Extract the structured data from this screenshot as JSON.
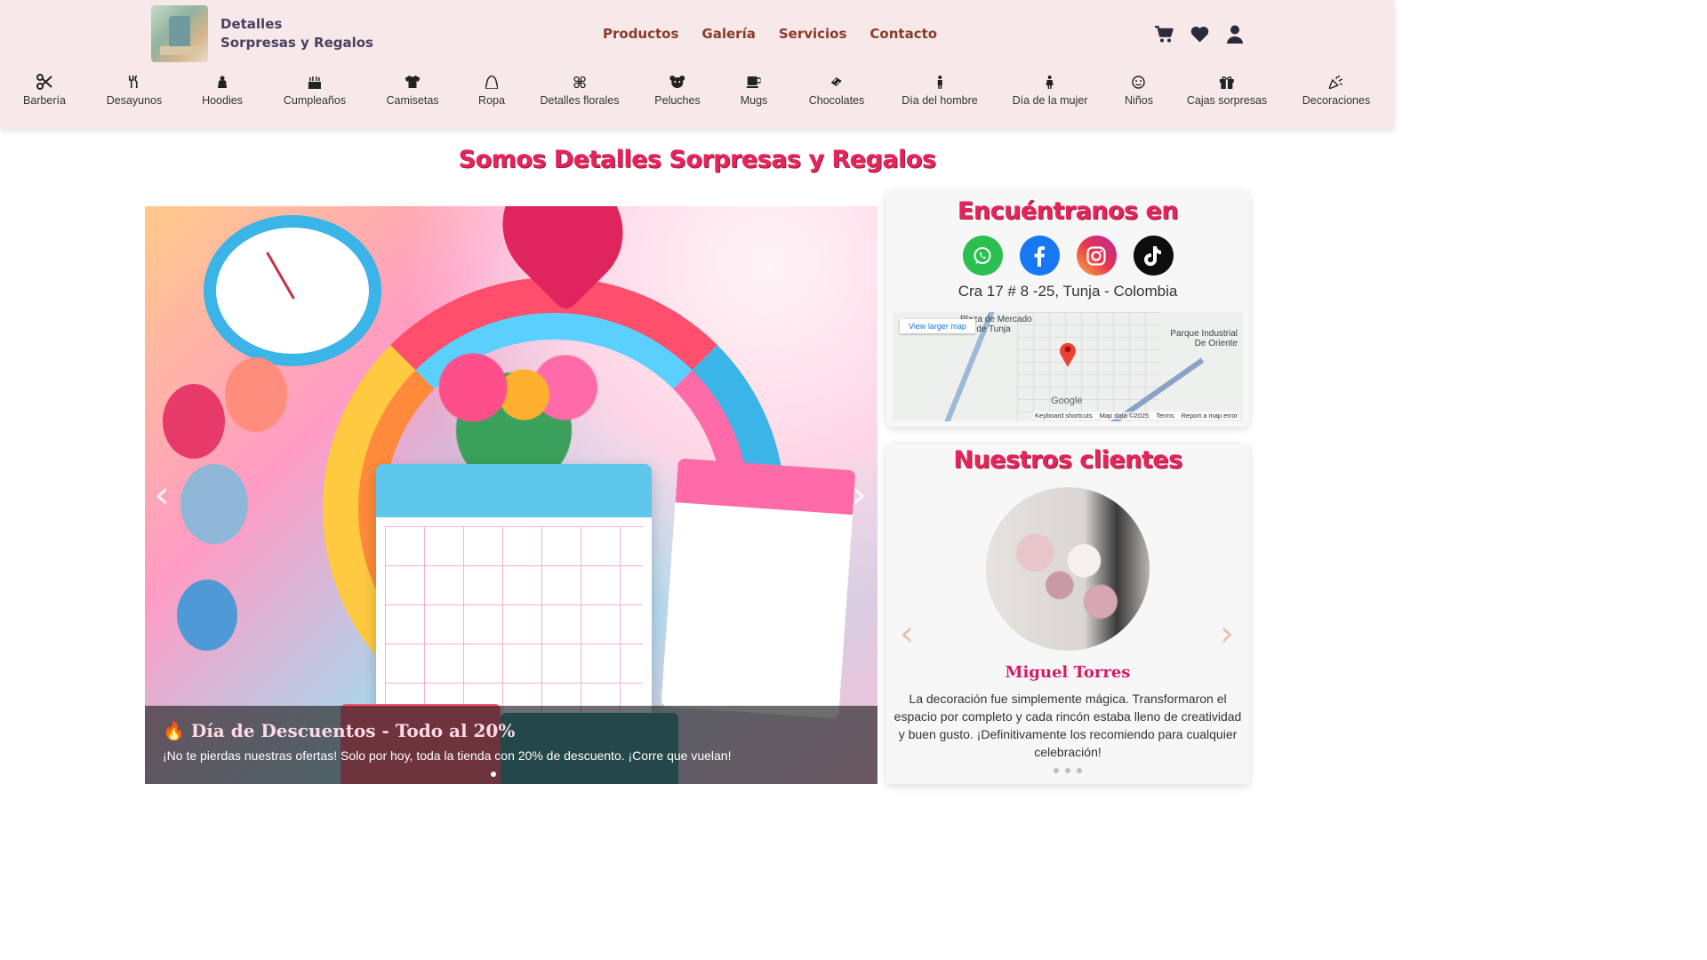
{
  "brand": {
    "line1": "Detalles",
    "line2": "Sorpresas y Regalos"
  },
  "nav": [
    {
      "label": "Productos"
    },
    {
      "label": "Galería"
    },
    {
      "label": "Servicios"
    },
    {
      "label": "Contacto"
    }
  ],
  "header_icons": [
    "cart-icon",
    "heart-icon",
    "user-icon"
  ],
  "categories": [
    {
      "label": "Barbería",
      "icon": "scissors-icon"
    },
    {
      "label": "Desayunos",
      "icon": "utensils-icon"
    },
    {
      "label": "Hoodies",
      "icon": "hoodie-icon"
    },
    {
      "label": "Cumpleaños",
      "icon": "birthday-cake-icon"
    },
    {
      "label": "Camisetas",
      "icon": "tshirt-icon"
    },
    {
      "label": "Ropa",
      "icon": "clothes-icon"
    },
    {
      "label": "Detalles florales",
      "icon": "flower-icon"
    },
    {
      "label": "Peluches",
      "icon": "teddy-bear-icon"
    },
    {
      "label": "Mugs",
      "icon": "mug-icon"
    },
    {
      "label": "Chocolates",
      "icon": "candy-icon"
    },
    {
      "label": "Día del hombre",
      "icon": "man-icon"
    },
    {
      "label": "Día de la mujer",
      "icon": "woman-icon"
    },
    {
      "label": "Niños",
      "icon": "child-face-icon"
    },
    {
      "label": "Cajas sorpresas",
      "icon": "gift-icon"
    },
    {
      "label": "Decoraciones",
      "icon": "party-popper-icon"
    }
  ],
  "page_title": "Somos Detalles Sorpresas y Regalos",
  "hero": {
    "caption_title": "🔥 Día de Descuentos - Todo al 20%",
    "caption_text": "¡No te pierdas nuestras ofertas! Solo por hoy, toda la tienda con 20% de descuento. ¡Corre que vuelan!",
    "prev": "‹",
    "next": "›"
  },
  "find_us": {
    "title": "Encuéntranos en",
    "socials": [
      "whatsapp-icon",
      "facebook-icon",
      "instagram-icon",
      "tiktok-icon"
    ],
    "address": "Cra 17 # 8 -25, Tunja - Colombia",
    "map": {
      "larger_map": "View larger map",
      "label_left": "Plaza de Mercado Sur de Tunja",
      "label_right": "Parque Industrial De Oriente",
      "google": "Google",
      "shortcuts": "Keyboard shortcuts",
      "data": "Map data ©2025",
      "terms": "Terms",
      "report": "Report a map error"
    }
  },
  "clients": {
    "title": "Nuestros clientes",
    "name": "Miguel Torres",
    "quote": "La decoración fue simplemente mágica. Transformaron el espacio por completo y cada rincón estaba lleno de creatividad y buen gusto. ¡Definitivamente los recomiendo para cualquier celebración!",
    "prev": "‹",
    "next": "›",
    "slide_count": 3
  },
  "colors": {
    "header_bg": "#f7e9ea",
    "title_pink": "#e4245a",
    "nav_brown": "#8a3a2a",
    "client_name": "#d81b60"
  }
}
